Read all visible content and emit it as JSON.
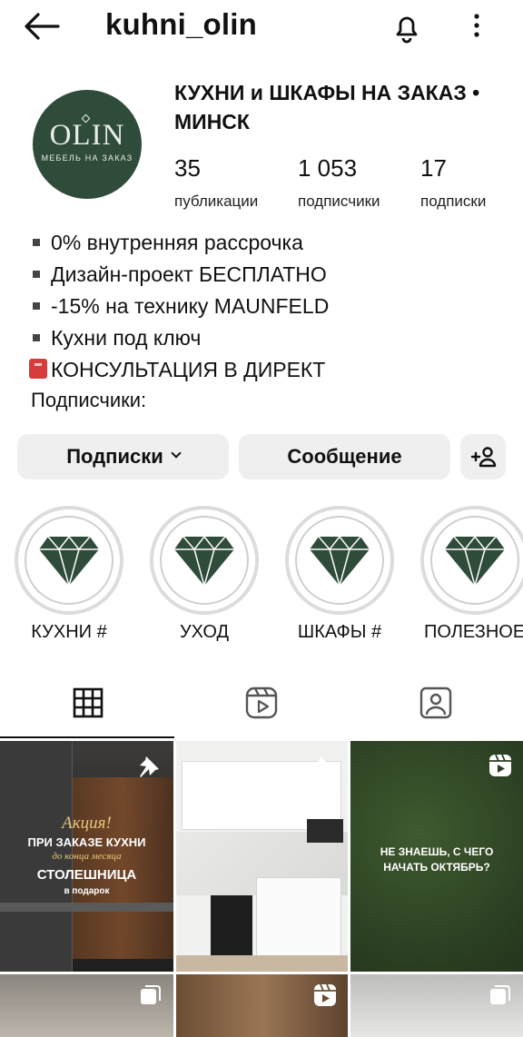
{
  "header": {
    "username": "kuhni_olin"
  },
  "profile": {
    "avatar_logo": "OLIN",
    "avatar_subtitle": "МЕБЕЛЬ НА ЗАКАЗ",
    "name_line1": "КУХНИ и ШКАФЫ НА ЗАКАЗ •",
    "name_line2": "МИНСК",
    "stats": [
      {
        "value": "35",
        "label": "публикации"
      },
      {
        "value": "1 053",
        "label": "подписчики"
      },
      {
        "value": "17",
        "label": "подписки"
      }
    ]
  },
  "bio": {
    "lines": [
      "0% внутренняя рассрочка",
      "Дизайн-проект БЕСПЛАТНО",
      "-15% на технику MAUNFELD",
      "Кухни под ключ"
    ],
    "cta": "КОНСУЛЬТАЦИЯ В ДИРЕКТ",
    "followers_label": "Подписчики:"
  },
  "actions": {
    "following_label": "Подписки",
    "message_label": "Сообщение"
  },
  "highlights": [
    {
      "label": "КУХНИ #"
    },
    {
      "label": "УХОД"
    },
    {
      "label": "ШКАФЫ #"
    },
    {
      "label": "ПОЛЕЗНОЕ"
    }
  ],
  "tabs": [
    {
      "icon": "grid-icon",
      "active": true
    },
    {
      "icon": "reels-icon",
      "active": false
    },
    {
      "icon": "tagged-icon",
      "active": false
    }
  ],
  "posts": [
    {
      "badge": "pin-icon",
      "promo_title": "Акция!",
      "promo_line1": "ПРИ ЗАКАЗЕ КУХНИ",
      "promo_line2": "до конца месяца",
      "promo_line3": "СТОЛЕШНИЦА",
      "promo_line4": "в подарок"
    },
    {
      "badge": "pin-icon"
    },
    {
      "badge": "reels-icon",
      "text_line1": "НЕ ЗНАЕШЬ, С ЧЕГО",
      "text_line2": "НАЧАТЬ ОКТЯБРЬ?"
    },
    {
      "badge": "carousel-icon"
    },
    {
      "badge": "reels-icon"
    },
    {
      "badge": "carousel-icon"
    }
  ],
  "colors": {
    "brand_green": "#2f4b3a",
    "button_bg": "#efefef",
    "text": "#111111"
  }
}
